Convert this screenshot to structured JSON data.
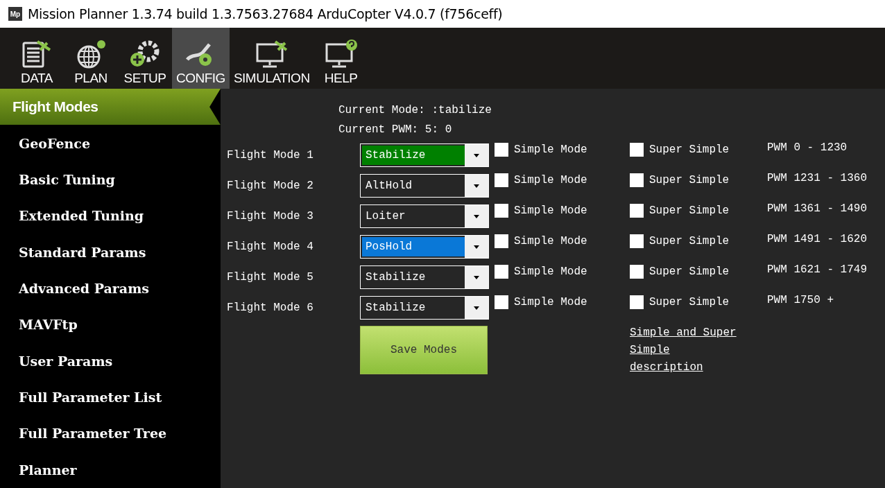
{
  "window": {
    "logo_text": "Mp",
    "title": "Mission Planner 1.3.74 build 1.3.7563.27684 ArduCopter V4.0.7 (f756ceff)"
  },
  "toolbar": [
    {
      "label": "DATA",
      "kind": "data",
      "selected": false
    },
    {
      "label": "PLAN",
      "kind": "plan",
      "selected": false
    },
    {
      "label": "SETUP",
      "kind": "setup",
      "selected": false
    },
    {
      "label": "CONFIG",
      "kind": "config",
      "selected": true
    },
    {
      "label": "SIMULATION",
      "kind": "simulation",
      "selected": false
    },
    {
      "label": "HELP",
      "kind": "help",
      "selected": false
    }
  ],
  "sidebar": {
    "items": [
      {
        "label": "Flight Modes",
        "selected": true
      },
      {
        "label": "GeoFence",
        "selected": false
      },
      {
        "label": "Basic Tuning",
        "selected": false
      },
      {
        "label": "Extended Tuning",
        "selected": false
      },
      {
        "label": "Standard Params",
        "selected": false
      },
      {
        "label": "Advanced Params",
        "selected": false
      },
      {
        "label": "MAVFtp",
        "selected": false
      },
      {
        "label": "User Params",
        "selected": false
      },
      {
        "label": "Full Parameter List",
        "selected": false
      },
      {
        "label": "Full Parameter Tree",
        "selected": false
      },
      {
        "label": "Planner",
        "selected": false
      }
    ]
  },
  "status": {
    "current_mode": "Current Mode: :tabilize",
    "current_pwm": "Current PWM:  5: 0"
  },
  "modes": [
    {
      "label": "Flight Mode 1",
      "value": "Stabilize",
      "current": true,
      "selected": false,
      "simple_label": "Simple Mode",
      "simple_checked": false,
      "super_label": "Super Simple",
      "super_checked": false,
      "pwm": "PWM 0 - 1230"
    },
    {
      "label": "Flight Mode 2",
      "value": "AltHold",
      "current": false,
      "selected": false,
      "simple_label": "Simple Mode",
      "simple_checked": false,
      "super_label": "Super Simple",
      "super_checked": false,
      "pwm": "PWM 1231 - 1360"
    },
    {
      "label": "Flight Mode 3",
      "value": "Loiter",
      "current": false,
      "selected": false,
      "simple_label": "Simple Mode",
      "simple_checked": false,
      "super_label": "Super Simple",
      "super_checked": false,
      "pwm": "PWM 1361 - 1490"
    },
    {
      "label": "Flight Mode 4",
      "value": "PosHold",
      "current": false,
      "selected": true,
      "simple_label": "Simple Mode",
      "simple_checked": false,
      "super_label": "Super Simple",
      "super_checked": false,
      "pwm": "PWM 1491 - 1620"
    },
    {
      "label": "Flight Mode 5",
      "value": "Stabilize",
      "current": false,
      "selected": false,
      "simple_label": "Simple Mode",
      "simple_checked": false,
      "super_label": "Super Simple",
      "super_checked": false,
      "pwm": "PWM 1621 - 1749"
    },
    {
      "label": "Flight Mode 6",
      "value": "Stabilize",
      "current": false,
      "selected": false,
      "simple_label": "Simple Mode",
      "simple_checked": false,
      "super_label": "Super Simple",
      "super_checked": false,
      "pwm": "PWM 1750 +"
    }
  ],
  "save_button": "Save Modes",
  "description_link": "Simple and Super Simple description"
}
